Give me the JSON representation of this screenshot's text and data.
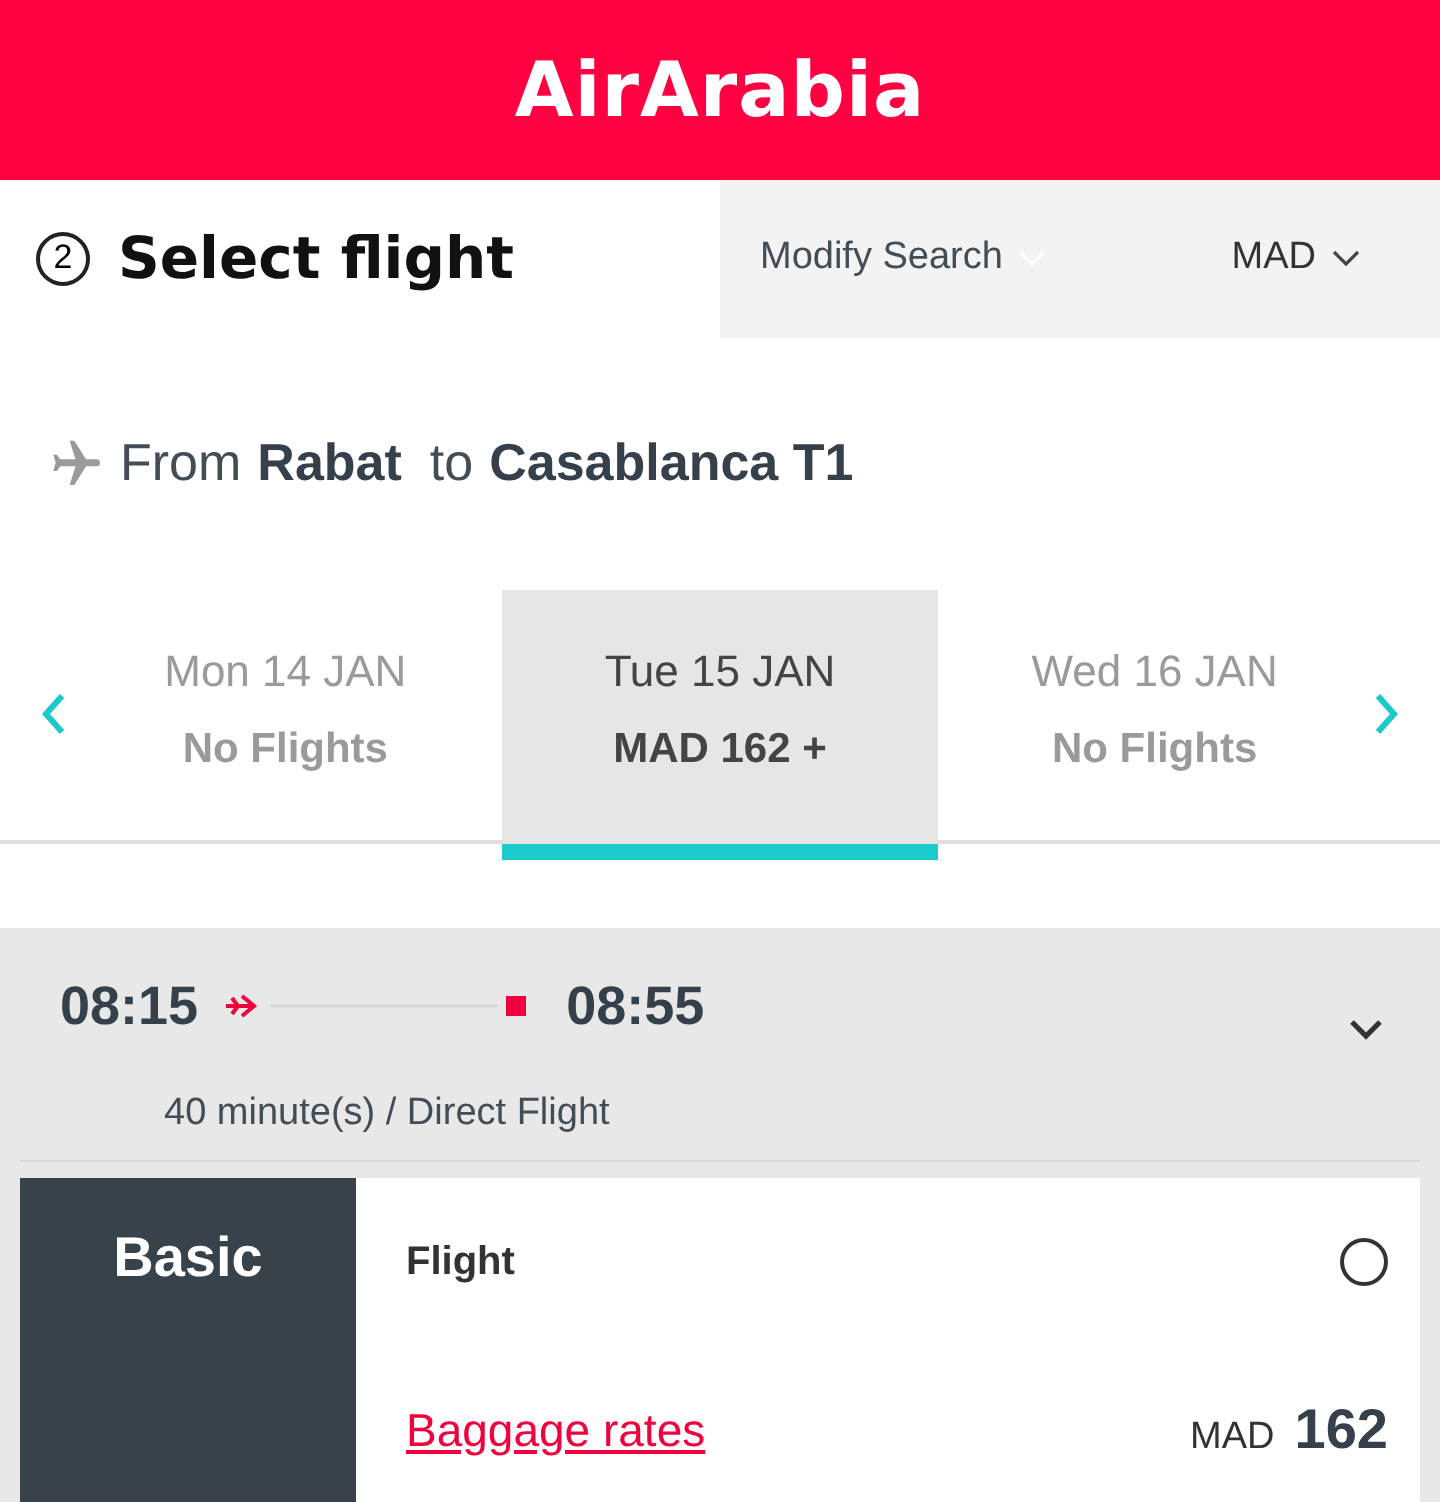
{
  "header": {
    "logo": "AirArabia"
  },
  "step": {
    "number": "2",
    "title": "Select flight"
  },
  "actions": [
    {
      "label": "Modify Search"
    },
    {
      "label": "MAD"
    }
  ],
  "route": {
    "from_word": "From",
    "origin": "Rabat",
    "to_word": "to",
    "destination": "Casablanca T1"
  },
  "dates": [
    {
      "day": "Mon 14 JAN",
      "fare": "No Flights",
      "selected": false
    },
    {
      "day": "Tue 15 JAN",
      "fare": "MAD 162 +",
      "selected": true
    },
    {
      "day": "Wed 16 JAN",
      "fare": "No Flights",
      "selected": false
    }
  ],
  "flight": {
    "depart": "08:15",
    "arrive": "08:55",
    "duration": "40 minute(s) / Direct Flight",
    "expanded": false
  },
  "fare": {
    "name": "Basic",
    "option": "Flight",
    "selected": false,
    "link": "Baggage rates",
    "currency": "MAD",
    "price": "162"
  }
}
